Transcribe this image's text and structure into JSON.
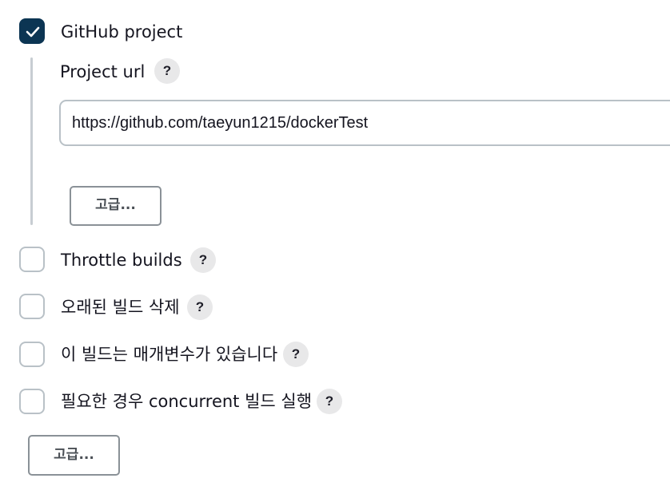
{
  "github_project": {
    "checked": true,
    "label": "GitHub project",
    "project_url_label": "Project url",
    "help": "?",
    "url_value": "https://github.com/taeyun1215/dockerTest",
    "advanced_label": "고급..."
  },
  "options": [
    {
      "label": "Throttle builds",
      "checked": false,
      "help": "?"
    },
    {
      "label": "오래된 빌드 삭제",
      "checked": false,
      "help": "?"
    },
    {
      "label": "이 빌드는 매개변수가 있습니다",
      "checked": false,
      "help": "?"
    },
    {
      "label": "필요한 경우 concurrent 빌드 실행",
      "checked": false,
      "help": "?"
    }
  ],
  "advanced_button_label": "고급...",
  "colors": {
    "checkbox_checked": "#0c3553",
    "checkbox_border": "#b9c1c7",
    "help_bg": "#e8e8e9",
    "button_border": "#8a9197"
  }
}
